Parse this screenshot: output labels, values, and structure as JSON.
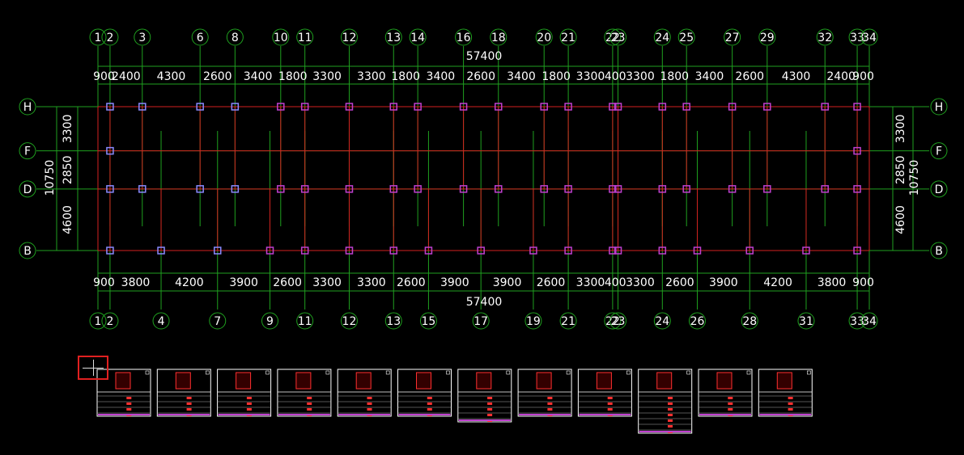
{
  "drawing": {
    "overall_dimension_top": "57400",
    "overall_dimension_bottom": "57400",
    "top_axes": [
      {
        "label": "1",
        "pos": 0
      },
      {
        "label": "2",
        "pos": 900
      },
      {
        "label": "3",
        "pos": 3300
      },
      {
        "label": "6",
        "pos": 7600
      },
      {
        "label": "8",
        "pos": 10200
      },
      {
        "label": "10",
        "pos": 13600
      },
      {
        "label": "11",
        "pos": 15400
      },
      {
        "label": "12",
        "pos": 18700
      },
      {
        "label": "13",
        "pos": 22000
      },
      {
        "label": "14",
        "pos": 23800
      },
      {
        "label": "16",
        "pos": 27200
      },
      {
        "label": "18",
        "pos": 29800
      },
      {
        "label": "20",
        "pos": 33200
      },
      {
        "label": "21",
        "pos": 35000
      },
      {
        "label": "22",
        "pos": 38300
      },
      {
        "label": "23",
        "pos": 38700
      },
      {
        "label": "24",
        "pos": 42000
      },
      {
        "label": "25",
        "pos": 43800
      },
      {
        "label": "27",
        "pos": 47200
      },
      {
        "label": "29",
        "pos": 49800
      },
      {
        "label": "32",
        "pos": 54100
      },
      {
        "label": "33",
        "pos": 56500
      },
      {
        "label": "34",
        "pos": 57400
      }
    ],
    "bottom_axes": [
      {
        "label": "1",
        "pos": 0
      },
      {
        "label": "2",
        "pos": 900
      },
      {
        "label": "4",
        "pos": 4700
      },
      {
        "label": "7",
        "pos": 8900
      },
      {
        "label": "9",
        "pos": 12800
      },
      {
        "label": "11",
        "pos": 15400
      },
      {
        "label": "12",
        "pos": 18700
      },
      {
        "label": "13",
        "pos": 22000
      },
      {
        "label": "15",
        "pos": 24600
      },
      {
        "label": "17",
        "pos": 28500
      },
      {
        "label": "19",
        "pos": 32400
      },
      {
        "label": "21",
        "pos": 35000
      },
      {
        "label": "22",
        "pos": 38300
      },
      {
        "label": "23",
        "pos": 38700
      },
      {
        "label": "24",
        "pos": 42000
      },
      {
        "label": "26",
        "pos": 44600
      },
      {
        "label": "28",
        "pos": 48500
      },
      {
        "label": "31",
        "pos": 52700
      },
      {
        "label": "33",
        "pos": 56500
      },
      {
        "label": "34",
        "pos": 57400
      }
    ],
    "top_spans": [
      "900",
      "2400",
      "4300",
      "2600",
      "3400",
      "1800",
      "3300",
      "3300",
      "1800",
      "3400",
      "2600",
      "3400",
      "1800",
      "3300",
      "400",
      "3300",
      "1800",
      "3400",
      "2600",
      "4300",
      "2400",
      "900"
    ],
    "bottom_spans": [
      "900",
      "3800",
      "4200",
      "3900",
      "2600",
      "3300",
      "3300",
      "2600",
      "3900",
      "3900",
      "2600",
      "3300",
      "400",
      "3300",
      "2600",
      "3900",
      "4200",
      "3800",
      "900"
    ],
    "row_axes": [
      {
        "label": "H",
        "pos": 10750
      },
      {
        "label": "F",
        "pos": 7450
      },
      {
        "label": "D",
        "pos": 4600
      },
      {
        "label": "B",
        "pos": 0
      }
    ],
    "left_total": "10750",
    "right_total": "10750",
    "row_spans": [
      "3300",
      "2850",
      "4600"
    ]
  },
  "sheets": [
    {
      "id": 1,
      "rows": 4
    },
    {
      "id": 2,
      "rows": 4
    },
    {
      "id": 3,
      "rows": 4
    },
    {
      "id": 4,
      "rows": 4
    },
    {
      "id": 5,
      "rows": 4
    },
    {
      "id": 6,
      "rows": 4
    },
    {
      "id": 7,
      "rows": 5
    },
    {
      "id": 8,
      "rows": 4
    },
    {
      "id": 9,
      "rows": 4
    },
    {
      "id": 10,
      "rows": 7
    },
    {
      "id": 11,
      "rows": 4
    },
    {
      "id": 12,
      "rows": 4
    }
  ],
  "colors": {
    "background": "#000000",
    "axis_line": "#1fa01f",
    "beam": "#d42020",
    "text": "#ffffff",
    "column_a": "#8a8aff",
    "column_b": "#c040d0",
    "cursor_frame": "#e02020"
  }
}
